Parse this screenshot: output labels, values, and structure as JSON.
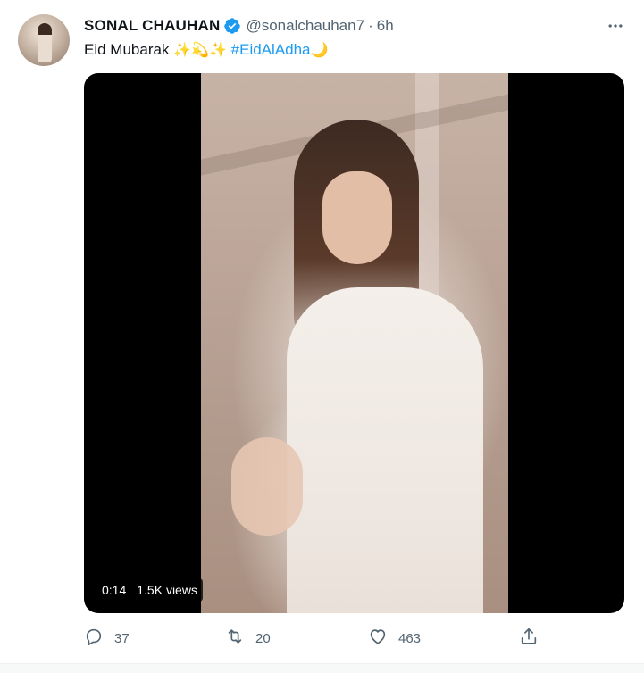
{
  "tweet": {
    "author": {
      "display_name": "SONAL CHAUHAN",
      "handle": "@sonalchauhan7",
      "verified": true,
      "avatar_icon": "profile-photo"
    },
    "separator": "·",
    "timestamp": "6h",
    "more_icon": "more-horizontal-icon",
    "text_prefix": "Eid Mubarak",
    "emojis_1": "✨💫✨",
    "hashtag": "#EidAlAdha",
    "emoji_2": "🌙",
    "media": {
      "type": "video",
      "duration": "0:14",
      "views": "1.5K views"
    },
    "actions": {
      "reply": {
        "icon": "reply-icon",
        "count": "37"
      },
      "retweet": {
        "icon": "retweet-icon",
        "count": "20"
      },
      "like": {
        "icon": "heart-icon",
        "count": "463"
      },
      "share": {
        "icon": "share-icon"
      }
    }
  },
  "colors": {
    "accent": "#1d9bf0",
    "secondary_text": "#536471",
    "primary_text": "#0f1419",
    "video_background": "#000000"
  }
}
